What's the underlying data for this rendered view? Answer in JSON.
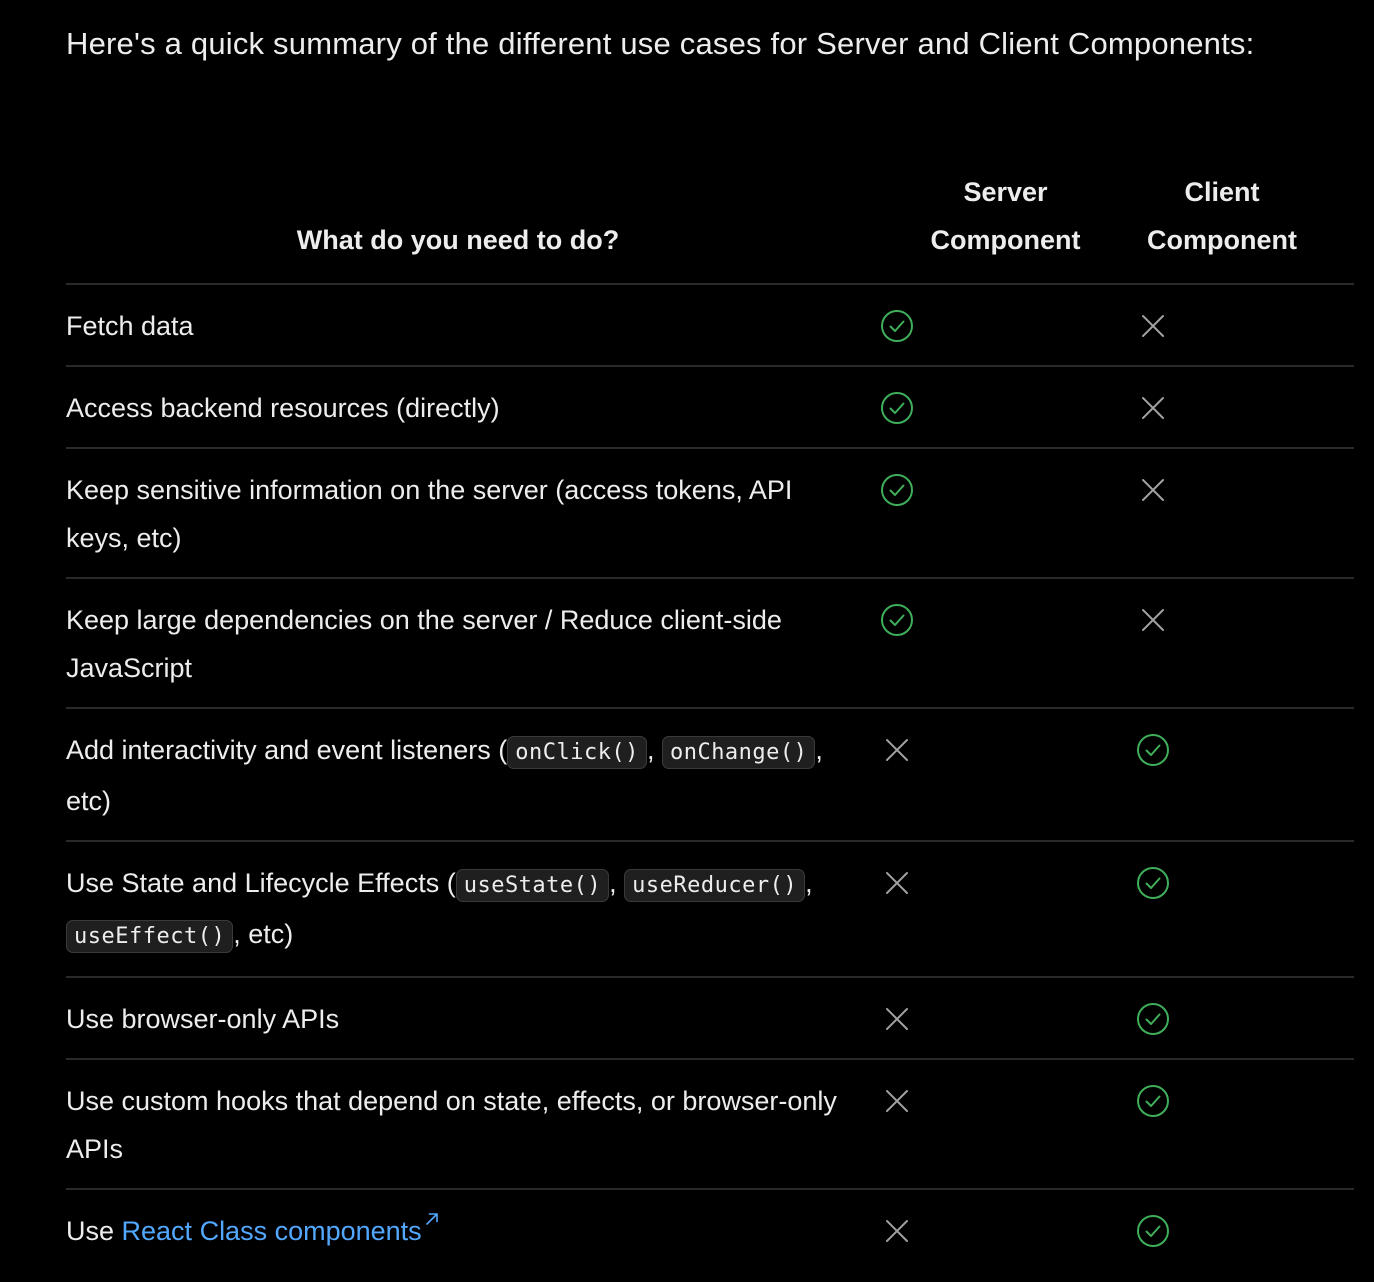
{
  "intro": "Here's a quick summary of the different use cases for Server and Client Components:",
  "header": {
    "need": "What do you need to do?",
    "server_line1": "Server",
    "server_line2": "Component",
    "client_line1": "Client",
    "client_line2": "Component"
  },
  "colors": {
    "check": "#3fae5a",
    "cross": "#a1a1a1",
    "link": "#52a8ff"
  },
  "rows": [
    {
      "parts": [
        {
          "t": "text",
          "v": "Fetch data"
        }
      ],
      "server": "check",
      "client": "cross"
    },
    {
      "parts": [
        {
          "t": "text",
          "v": "Access backend resources (directly)"
        }
      ],
      "server": "check",
      "client": "cross"
    },
    {
      "parts": [
        {
          "t": "text",
          "v": "Keep sensitive information on the server (access tokens, API keys, etc)"
        }
      ],
      "server": "check",
      "client": "cross"
    },
    {
      "parts": [
        {
          "t": "text",
          "v": "Keep large dependencies on the server / Reduce client-side JavaScript"
        }
      ],
      "server": "check",
      "client": "cross"
    },
    {
      "parts": [
        {
          "t": "text",
          "v": "Add interactivity and event listeners ("
        },
        {
          "t": "code",
          "v": "onClick()"
        },
        {
          "t": "text",
          "v": ", "
        },
        {
          "t": "code",
          "v": "onChange()"
        },
        {
          "t": "text",
          "v": ", etc)"
        }
      ],
      "server": "cross",
      "client": "check"
    },
    {
      "parts": [
        {
          "t": "text",
          "v": "Use State and Lifecycle Effects ("
        },
        {
          "t": "code",
          "v": "useState()"
        },
        {
          "t": "text",
          "v": ", "
        },
        {
          "t": "code",
          "v": "useReducer()"
        },
        {
          "t": "text",
          "v": ", "
        },
        {
          "t": "code",
          "v": "useEffect()"
        },
        {
          "t": "text",
          "v": ", etc)"
        }
      ],
      "server": "cross",
      "client": "check"
    },
    {
      "parts": [
        {
          "t": "text",
          "v": "Use browser-only APIs"
        }
      ],
      "server": "cross",
      "client": "check"
    },
    {
      "parts": [
        {
          "t": "text",
          "v": "Use custom hooks that depend on state, effects, or browser-only APIs"
        }
      ],
      "server": "cross",
      "client": "check"
    },
    {
      "parts": [
        {
          "t": "text",
          "v": "Use "
        },
        {
          "t": "link",
          "v": "React Class components",
          "icon": "external-link-icon"
        }
      ],
      "server": "cross",
      "client": "check"
    }
  ]
}
